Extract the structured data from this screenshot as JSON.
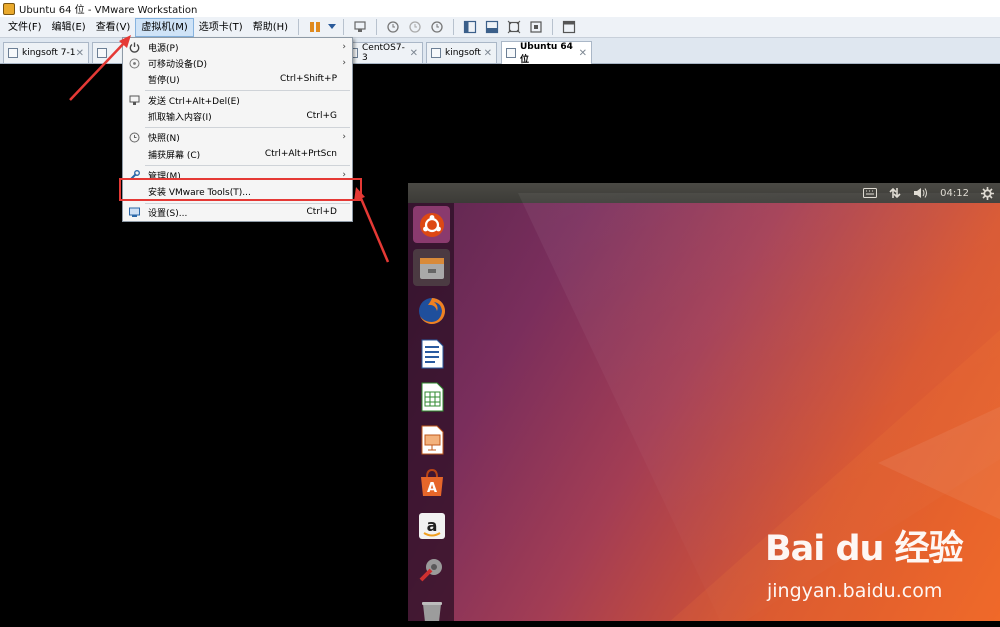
{
  "window": {
    "title": "Ubuntu 64 位 - VMware Workstation"
  },
  "menubar": {
    "items": [
      {
        "label": "文件(F)"
      },
      {
        "label": "编辑(E)"
      },
      {
        "label": "查看(V)"
      },
      {
        "label": "虚拟机(M)",
        "active": true
      },
      {
        "label": "选项卡(T)"
      },
      {
        "label": "帮助(H)"
      }
    ]
  },
  "toolbar": {
    "icons": [
      "pause-icon",
      "dropdown-arrow-icon",
      "send-keys-icon",
      "snapshot-take-icon",
      "snapshot-revert-icon",
      "snapshot-manager-icon",
      "library-icon",
      "console-view-icon",
      "fullscreen-icon",
      "unity-icon",
      "thumbnail-icon"
    ]
  },
  "tabs": [
    {
      "label": "kingsoft 7-1",
      "active": false
    },
    {
      "label": "kingsoft",
      "active": false
    },
    {
      "label": "CentOS7-3",
      "active": false
    },
    {
      "label": "kingsoft",
      "active": false
    },
    {
      "label": "Ubuntu 64 位",
      "active": true
    }
  ],
  "vm_menu": {
    "items": [
      {
        "label": "电源(P)",
        "shortcut": "",
        "submenu": true,
        "icon": "power-icon"
      },
      {
        "label": "可移动设备(D)",
        "shortcut": "",
        "submenu": true,
        "icon": "removable-devices-icon"
      },
      {
        "label": "暂停(U)",
        "shortcut": "Ctrl+Shift+P",
        "submenu": false,
        "icon": ""
      },
      {
        "label": "发送 Ctrl+Alt+Del(E)",
        "shortcut": "",
        "submenu": false,
        "icon": "send-keys-icon"
      },
      {
        "label": "抓取输入内容(I)",
        "shortcut": "Ctrl+G",
        "submenu": false,
        "icon": ""
      },
      {
        "label": "快照(N)",
        "shortcut": "",
        "submenu": true,
        "icon": "snapshot-icon"
      },
      {
        "label": "捕获屏幕 (C)",
        "shortcut": "Ctrl+Alt+PrtScn",
        "submenu": false,
        "icon": ""
      },
      {
        "label": "管理(M)",
        "shortcut": "",
        "submenu": true,
        "icon": "wrench-icon"
      },
      {
        "label": "安装 VMware Tools(T)...",
        "shortcut": "",
        "submenu": false,
        "icon": "",
        "highlighted": true
      },
      {
        "label": "设置(S)...",
        "shortcut": "Ctrl+D",
        "submenu": false,
        "icon": "settings-icon"
      }
    ]
  },
  "ubuntu": {
    "clock": "04:12",
    "launcher": [
      "ubuntu-dash-icon",
      "files-icon",
      "firefox-icon",
      "writer-icon",
      "calc-icon",
      "impress-icon",
      "software-center-icon",
      "amazon-icon",
      "system-settings-icon",
      "trash-icon"
    ],
    "indicators": [
      "keyboard-icon",
      "network-icon",
      "volume-icon",
      "gear-icon"
    ]
  },
  "watermark": {
    "brand": "Bai du 经验",
    "site": "jingyan.baidu.com"
  },
  "colors": {
    "highlight": "#e53935",
    "ubuntu_orange": "#e95420",
    "ubuntu_aubergine": "#5e2750"
  }
}
